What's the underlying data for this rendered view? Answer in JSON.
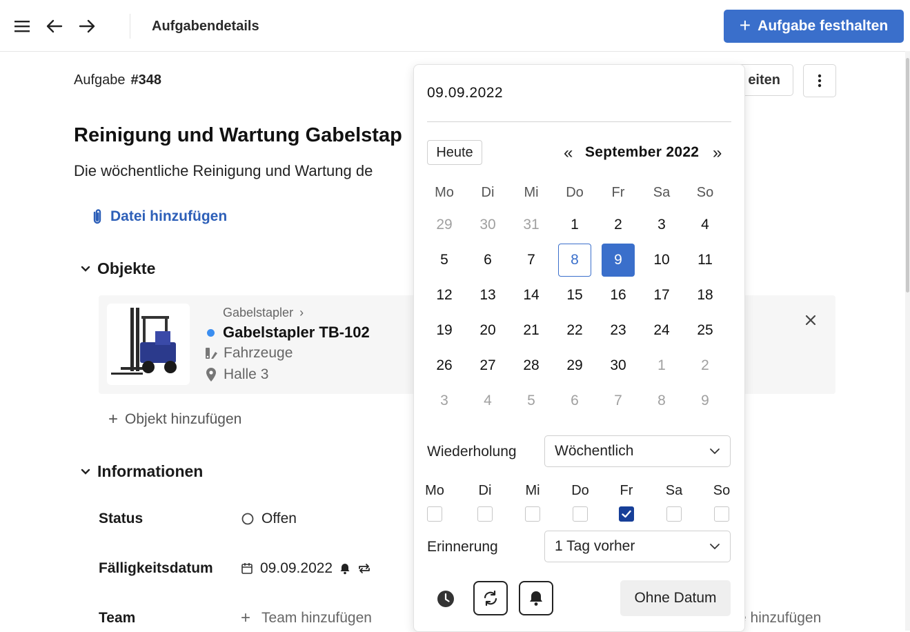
{
  "header": {
    "menu_icon": "hamburger-icon",
    "back_icon": "arrow-left-icon",
    "forward_icon": "arrow-right-icon",
    "title": "Aufgabendetails",
    "primary_button": "Aufgabe festhalten",
    "accent_color": "#3a6fcb"
  },
  "task": {
    "label": "Aufgabe",
    "number": "#348",
    "edit_button": "eiten",
    "title": "Reinigung und Wartung Gabelstap",
    "description": "Die wöchentliche Reinigung und Wartung de",
    "attach_label": "Datei hinzufügen"
  },
  "objects": {
    "section_title": "Objekte",
    "item": {
      "breadcrumb": "Gabelstapler",
      "name": "Gabelstapler TB-102",
      "category": "Fahrzeuge",
      "location": "Halle 3",
      "status_color": "#3b8ef0"
    },
    "add_label": "Objekt hinzufügen"
  },
  "info": {
    "section_title": "Informationen",
    "status_label": "Status",
    "status_value": "Offen",
    "due_label": "Fälligkeitsdatum",
    "due_value": "09.09.2022",
    "team_label": "Team",
    "team_value": "Team hinzufügen",
    "right_cut_text": "e hinzufügen"
  },
  "datepicker": {
    "input_value": "09.09.2022",
    "today_button": "Heute",
    "prev_label": "«",
    "next_label": "»",
    "month": "September 2022",
    "weekdays": [
      "Mo",
      "Di",
      "Mi",
      "Do",
      "Fr",
      "Sa",
      "So"
    ],
    "weeks": [
      [
        "29",
        "30",
        "31",
        "1",
        "2",
        "3",
        "4"
      ],
      [
        "5",
        "6",
        "7",
        "8",
        "9",
        "10",
        "11"
      ],
      [
        "12",
        "13",
        "14",
        "15",
        "16",
        "17",
        "18"
      ],
      [
        "19",
        "20",
        "21",
        "22",
        "23",
        "24",
        "25"
      ],
      [
        "26",
        "27",
        "28",
        "29",
        "30",
        "1",
        "2"
      ],
      [
        "3",
        "4",
        "5",
        "6",
        "7",
        "8",
        "9"
      ]
    ],
    "today_day": "8",
    "selected_day": "9",
    "repeat_label": "Wiederholung",
    "repeat_value": "Wöchentlich",
    "repeat_days": [
      "Mo",
      "Di",
      "Mi",
      "Do",
      "Fr",
      "Sa",
      "So"
    ],
    "repeat_checked": [
      false,
      false,
      false,
      false,
      true,
      false,
      false
    ],
    "reminder_label": "Erinnerung",
    "reminder_value": "1 Tag vorher",
    "no_date_button": "Ohne Datum"
  }
}
